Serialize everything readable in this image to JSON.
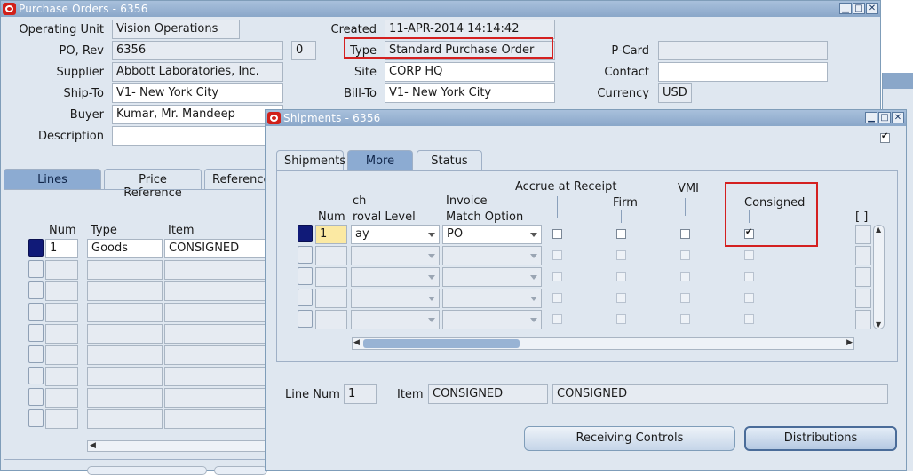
{
  "main_window": {
    "title": "Purchase Orders - 6356",
    "labels": {
      "operating_unit": "Operating Unit",
      "po_rev": "PO, Rev",
      "supplier": "Supplier",
      "ship_to": "Ship-To",
      "buyer": "Buyer",
      "description": "Description",
      "created": "Created",
      "type": "Type",
      "site": "Site",
      "bill_to": "Bill-To",
      "pcard": "P-Card",
      "contact": "Contact",
      "currency": "Currency"
    },
    "values": {
      "operating_unit": "Vision Operations",
      "po_number": "6356",
      "revision": "0",
      "supplier": "Abbott Laboratories, Inc.",
      "ship_to": "V1- New York City",
      "buyer": "Kumar, Mr. Mandeep",
      "description": "",
      "created": "11-APR-2014 14:14:42",
      "type": "Standard Purchase Order",
      "site": "CORP HQ",
      "bill_to": "V1- New York City",
      "pcard": "",
      "contact": "",
      "currency": "USD"
    },
    "tabs": [
      "Lines",
      "Price Reference",
      "Reference"
    ],
    "lines_headers": {
      "num": "Num",
      "type": "Type",
      "item": "Item"
    },
    "lines_rows": [
      {
        "num": "1",
        "type": "Goods",
        "item": "CONSIGNED"
      }
    ]
  },
  "shipments_window": {
    "title": "Shipments - 6356",
    "tabs": [
      "Shipments",
      "More",
      "Status"
    ],
    "active_tab": "More",
    "headers": {
      "num": "Num",
      "match_line1": "ch",
      "match_line2": "roval Level",
      "invoice_line1": "Invoice",
      "invoice_line2": "Match Option",
      "accrue": "Accrue at Receipt",
      "firm": "Firm",
      "vmi": "VMI",
      "consigned": "Consigned",
      "bracket": "[ ]"
    },
    "rows": [
      {
        "num": "1",
        "match_approval": "ay",
        "invoice_match": "PO",
        "accrue": false,
        "firm": false,
        "vmi": false,
        "consigned": true
      }
    ],
    "footer": {
      "line_num_label": "Line Num",
      "line_num": "1",
      "item_label": "Item",
      "item_code": "CONSIGNED",
      "item_description": "CONSIGNED"
    },
    "buttons": {
      "receiving_controls": "Receiving Controls",
      "distributions": "Distributions"
    }
  },
  "colors": {
    "titlebar": "#8aa7c9",
    "highlight_box": "#d42020",
    "window_bg": "#dfe7f0",
    "current_record": "#101a78"
  }
}
